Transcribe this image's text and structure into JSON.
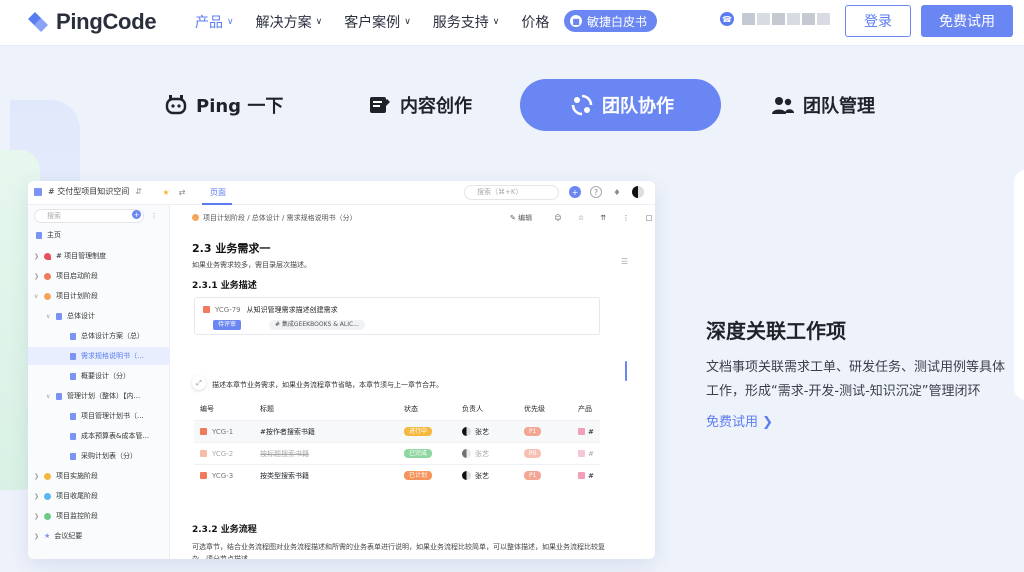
{
  "nav": {
    "logo": "PingCode",
    "menu": [
      {
        "label": "产品",
        "has_dropdown": true,
        "active": true
      },
      {
        "label": "解决方案",
        "has_dropdown": true
      },
      {
        "label": "客户案例",
        "has_dropdown": true
      },
      {
        "label": "服务支持",
        "has_dropdown": true
      },
      {
        "label": "价格",
        "has_dropdown": false
      }
    ],
    "whitepaper": "敏捷白皮书",
    "login": "登录",
    "free_trial": "免费试用"
  },
  "feature_tabs": [
    {
      "label": "Ping 一下",
      "icon": "robot-face-icon"
    },
    {
      "label": "内容创作",
      "icon": "document-edit-icon"
    },
    {
      "label": "团队协作",
      "icon": "sync-collab-icon",
      "active": true
    },
    {
      "label": "团队管理",
      "icon": "people-icon"
    }
  ],
  "doc": {
    "space_title": "# 交付型项目知识空间",
    "top_tab": "页面",
    "search_placeholder": "搜索（⌘+K）",
    "sidebar_search": "搜索",
    "tree": [
      {
        "label": "主页"
      },
      {
        "label": "# 项目管理制度"
      },
      {
        "label": "项目启动阶段"
      },
      {
        "label": "项目计划阶段"
      },
      {
        "label": "总体设计"
      },
      {
        "label": "总体设计方案（总）"
      },
      {
        "label": "需求规格说明书（..."
      },
      {
        "label": "概要设计（分）"
      },
      {
        "label": "管理计划（整体）【内..."
      },
      {
        "label": "项目管理计划书（..."
      },
      {
        "label": "成本预算表&成本管..."
      },
      {
        "label": "采购计划表（分）"
      },
      {
        "label": "项目实施阶段"
      },
      {
        "label": "项目收尾阶段"
      },
      {
        "label": "项目监控阶段"
      },
      {
        "label": "会议纪要"
      }
    ],
    "breadcrumb": "项目计划阶段  /  总体设计  /  需求规格说明书（分）",
    "edit": "编辑",
    "heading": "2.3  业务需求一",
    "intro": "如果业务需求较多，需目录层次描述。",
    "sub1": "2.3.1    业务描述",
    "work_item": {
      "id": "YCG-79",
      "title": "从知识管理需求描述创建需求",
      "status": "待评审",
      "tag": "# 集成GEEKBOOKS & ALIC..."
    },
    "desc": "描述本章节业务需求，如果业务流程章节省略，本章节须与上一章节合并。",
    "table": {
      "headers": [
        "编号",
        "标题",
        "状态",
        "负责人",
        "优先级",
        "产品"
      ],
      "rows": [
        {
          "id": "YCG-1",
          "title": "#按作者搜索书籍",
          "status": "进行中",
          "status_color": "#f5b83d",
          "owner": "张艺",
          "priority": "P1",
          "product": "#"
        },
        {
          "id": "YCG-2",
          "title": "按标题搜索书籍",
          "status": "已完成",
          "status_color": "#8ed6a0",
          "owner": "张艺",
          "priority": "P0",
          "product": "#"
        },
        {
          "id": "YCG-3",
          "title": "按类型搜索书籍",
          "status": "已计划",
          "status_color": "#f5935a",
          "owner": "张艺",
          "priority": "P1",
          "product": "#"
        }
      ]
    },
    "sub2": "2.3.2    业务流程",
    "flow_desc": "可选章节，结合业务流程图对业务流程描述和所需的业务表单进行说明，如果业务流程比较简单，可以整体描述，如果业务流程比较复杂，须分节点描述。"
  },
  "feature": {
    "title": "深度关联工作项",
    "desc": "文档事项关联需求工单、研发任务、测试用例等具体工作，形成“需求-开发-测试-知识沉淀”管理闭环",
    "link": "免费试用"
  },
  "colors": {
    "accent": "#6a86f2",
    "text": "#1f2329",
    "bg": "#eef2fb"
  }
}
